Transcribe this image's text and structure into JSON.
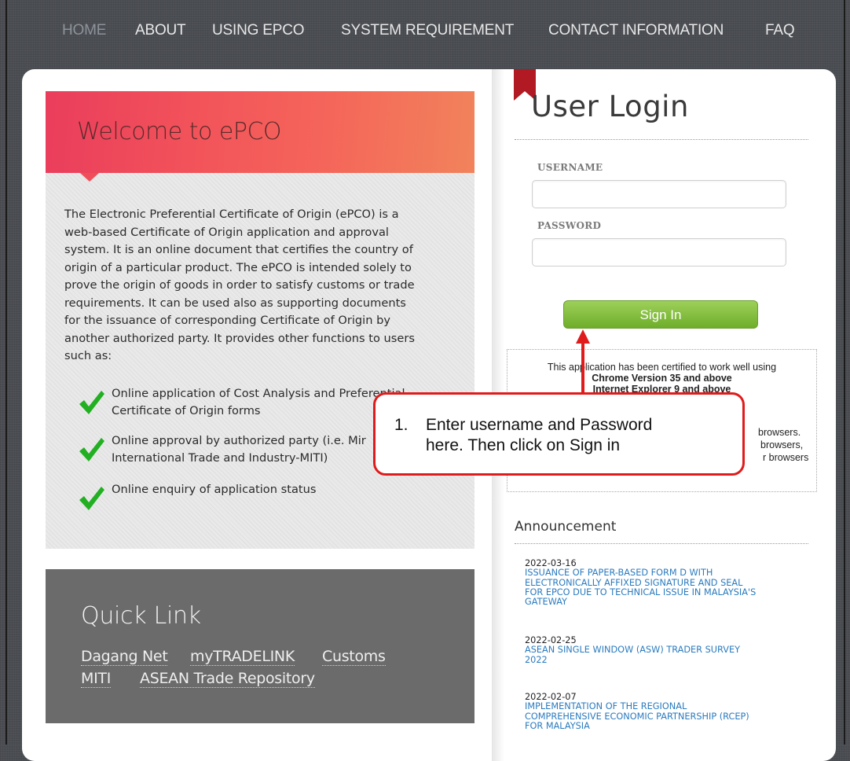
{
  "nav": {
    "items": [
      "HOME",
      "ABOUT",
      "USING EPCO",
      "SYSTEM REQUIREMENT",
      "CONTACT INFORMATION",
      "FAQ"
    ]
  },
  "welcome": {
    "title": "Welcome to ePCO",
    "intro": [
      "The Electronic Preferential Certificate of Origin (ePCO) is a",
      "web-based Certificate of Origin application and approval",
      "system. It is an online document that certifies the country of",
      "origin of a particular product. The ePCO is intended solely to",
      "prove the origin of goods in order to satisfy customs or trade",
      "requirements. It can be used also as supporting documents",
      "for the issuance of corresponding Certificate of Origin by",
      "another authorized party. It provides other functions to users",
      "such as:"
    ],
    "features": [
      {
        "line1": "Online application of Cost Analysis and Preferential",
        "line2": "Certificate of Origin forms"
      },
      {
        "line1": "Online approval by authorized party (i.e. Mir",
        "line2": "International Trade and Industry-MITI)"
      },
      {
        "line1": "Online enquiry of application status",
        "line2": ""
      }
    ]
  },
  "quick_link": {
    "title": "Quick Link",
    "links": [
      "Dagang Net",
      "myTRADELINK",
      "Customs",
      "MITI",
      "ASEAN Trade Repository"
    ]
  },
  "login": {
    "title": "User Login",
    "username_label": "USERNAME",
    "username_value": "",
    "password_label": "PASSWORD",
    "password_value": "",
    "sign_in": "Sign In"
  },
  "compat": {
    "line1": "This application has been certified to work well using",
    "line2": "Chrome Version 35 and above",
    "line3": "Internet Explorer 9 and above",
    "side1": "browsers.",
    "side2": "browsers,",
    "side3": "r browsers"
  },
  "announcement": {
    "title": "Announcement",
    "items": [
      {
        "date": "2022-03-16",
        "lines": [
          "ISSUANCE OF PAPER-BASED FORM D WITH",
          "ELECTRONICALLY AFFIXED SIGNATURE AND SEAL",
          "FOR EPCO DUE TO TECHNICAL ISSUE IN MALAYSIA'S",
          "GATEWAY"
        ]
      },
      {
        "date": "2022-02-25",
        "lines": [
          "ASEAN SINGLE WINDOW (ASW) TRADER SURVEY",
          "2022"
        ]
      },
      {
        "date": "2022-02-07",
        "lines": [
          "IMPLEMENTATION OF THE REGIONAL",
          "COMPREHENSIVE ECONOMIC PARTNERSHIP (RCEP)",
          "FOR MALAYSIA"
        ]
      }
    ]
  },
  "callout": {
    "number": "1.",
    "line1": "Enter username and Password",
    "line2": "here. Then click on Sign in"
  },
  "colors": {
    "accent_red": "#e01b1b",
    "sign_in_green": "#7fbf3a",
    "link_blue": "#2a7bbf",
    "banner_red": "#f04d5a"
  }
}
